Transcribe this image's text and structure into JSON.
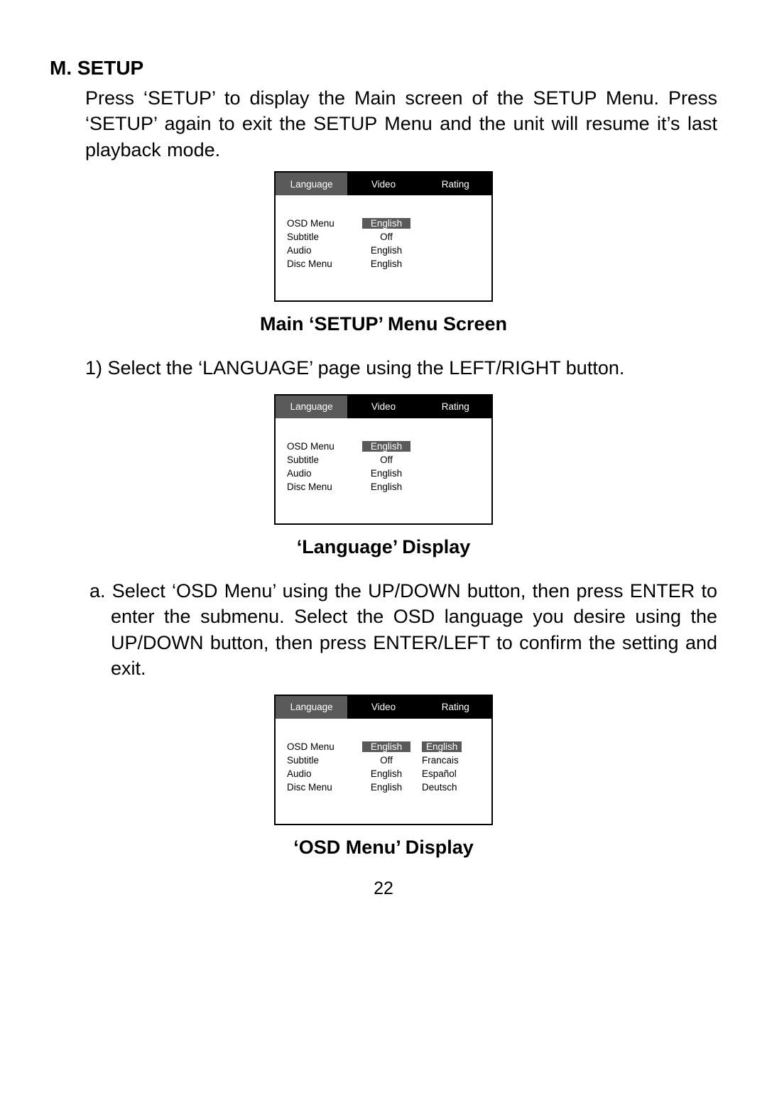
{
  "heading": "M. SETUP",
  "intro": "Press ‘SETUP’ to display the Main screen of the SETUP Menu. Press ‘SETUP’ again to exit  the SETUP Menu and the unit  will resume it’s last playback mode.",
  "sub1": "Main ‘SETUP’ Menu Screen",
  "step1": "1) Select the ‘LANGUAGE’ page using the LEFT/RIGHT button.",
  "sub2": "‘Language’ Display",
  "stepA": "a. Select ‘OSD Menu’ using the UP/DOWN button, then press ENTER to enter  the submenu. Select  the OSD  language you desire using  the UP/DOWN button, then press ENTER/LEFT to confirm the setting and exit.",
  "sub3": "‘OSD Menu’ Display",
  "page": "22",
  "menu": {
    "tabs": [
      "Language",
      "Video",
      "Rating"
    ],
    "items": [
      "OSD Menu",
      "Subtitle",
      "Audio",
      "Disc Menu"
    ],
    "values": [
      "English",
      "Off",
      "English",
      "English"
    ],
    "options": [
      "English",
      "Francais",
      "Español",
      "Deutsch"
    ]
  }
}
